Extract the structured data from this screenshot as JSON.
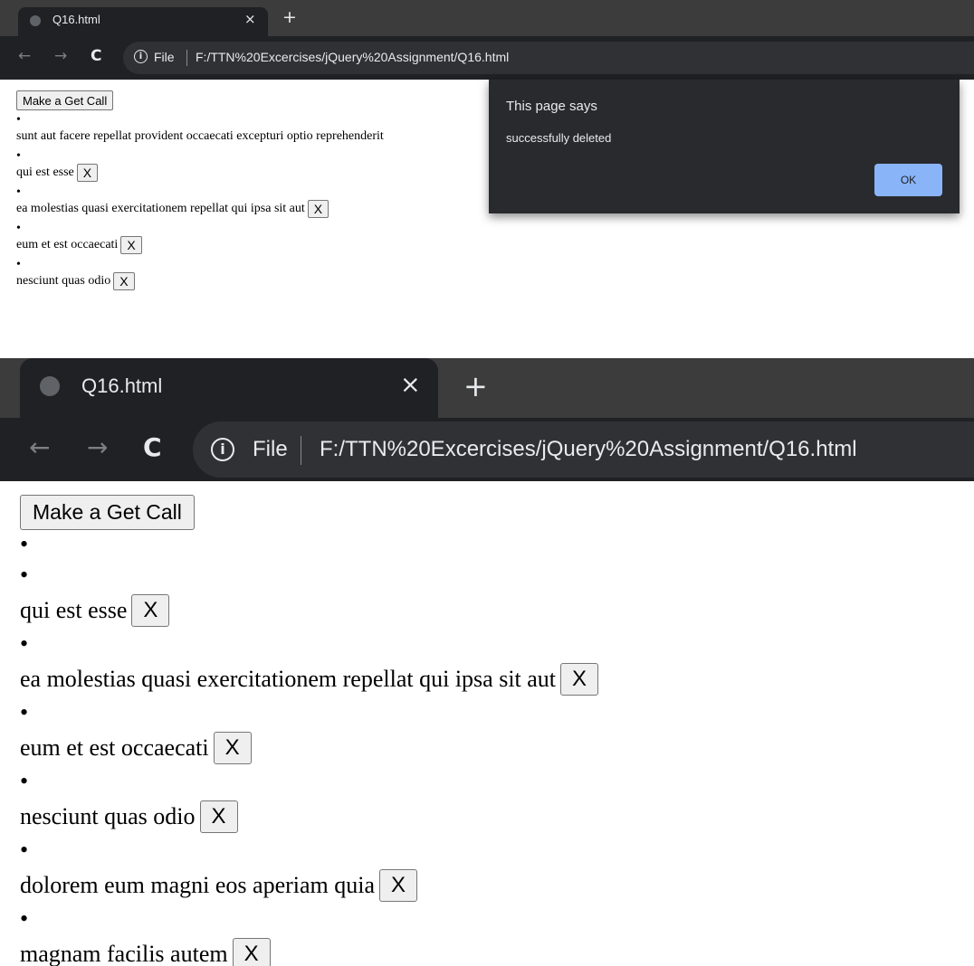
{
  "browser": {
    "tab_title": "Q16.html",
    "tab_close": "×",
    "new_tab": "+",
    "nav_back": "←",
    "nav_forward": "→",
    "nav_reload": "C",
    "info_icon": "i",
    "file_label": "File",
    "url": "F:/TTN%20Excercises/jQuery%20Assignment/Q16.html"
  },
  "page": {
    "get_button": "Make a Get Call",
    "bullet": "•",
    "delete_label": "X"
  },
  "shot1": {
    "posts": [
      {
        "title": "sunt aut facere repellat provident occaecati excepturi optio reprehenderit"
      },
      {
        "title": "qui est esse"
      },
      {
        "title": "ea molestias quasi exercitationem repellat qui ipsa sit aut"
      },
      {
        "title": "eum et est occaecati"
      },
      {
        "title": "nesciunt quas odio"
      }
    ]
  },
  "dialog": {
    "title": "This page says",
    "message": "successfully deleted",
    "ok_label": "OK"
  },
  "shot2": {
    "posts": [
      {
        "title": ""
      },
      {
        "title": "qui est esse"
      },
      {
        "title": "ea molestias quasi exercitationem repellat qui ipsa sit aut"
      },
      {
        "title": "eum et est occaecati"
      },
      {
        "title": "nesciunt quas odio"
      },
      {
        "title": "dolorem eum magni eos aperiam quia"
      },
      {
        "title": "magnam facilis autem"
      }
    ]
  },
  "colors": {
    "tabbar": "#3c3c3c",
    "toolbar": "#202124",
    "omnibox": "#303134",
    "dialog_bg": "#292a2d",
    "ok_button": "#8ab4f8"
  }
}
